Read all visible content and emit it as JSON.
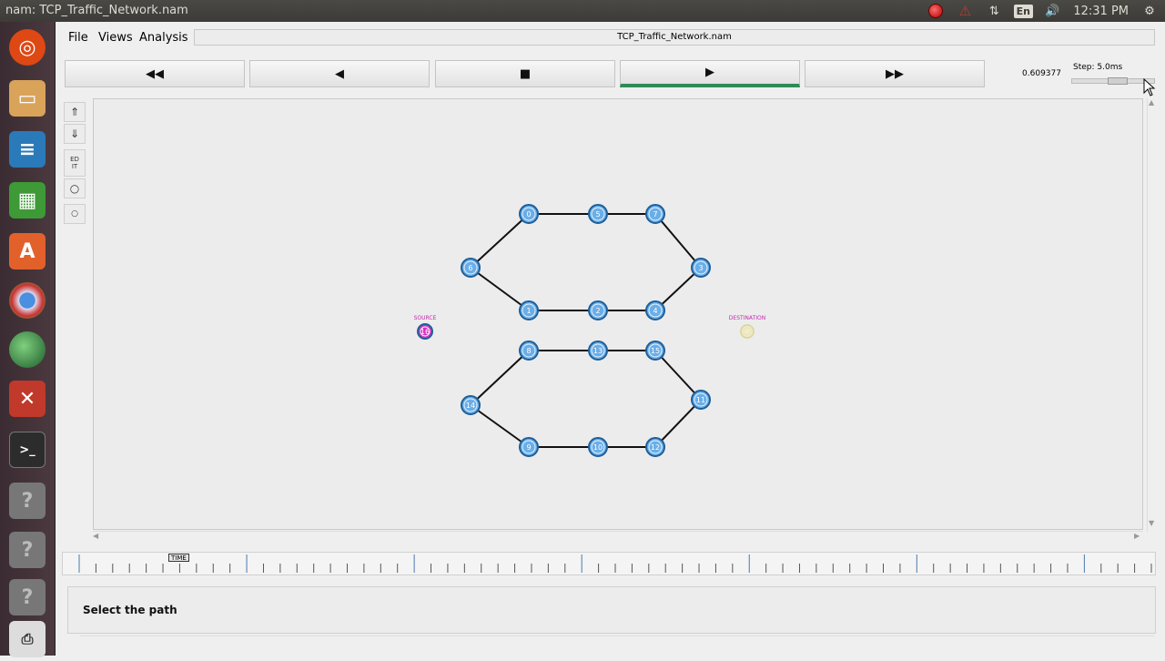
{
  "window": {
    "title": "nam: TCP_Traffic_Network.nam"
  },
  "tray": {
    "lang": "En",
    "clock": "12:31 PM"
  },
  "menu": {
    "file": "File",
    "views": "Views",
    "analysis": "Analysis"
  },
  "file_title": "TCP_Traffic_Network.nam",
  "controls": {
    "rewind": "◀◀",
    "back": "◀",
    "stop": "■",
    "play": "▶",
    "fast_forward": "▶▶",
    "time": "0.609377",
    "step_label": "Step: 5.0ms",
    "step_position": 0.55
  },
  "tools": {
    "edit": "ED\nIT"
  },
  "network": {
    "nodes": [
      {
        "id": "n0",
        "label": "0"
      },
      {
        "id": "n5",
        "label": "5"
      },
      {
        "id": "n7",
        "label": "7"
      },
      {
        "id": "n6",
        "label": "6"
      },
      {
        "id": "n3",
        "label": "3"
      },
      {
        "id": "n1",
        "label": "1"
      },
      {
        "id": "n2",
        "label": "2"
      },
      {
        "id": "n4",
        "label": "4"
      },
      {
        "id": "n8",
        "label": "8"
      },
      {
        "id": "n13",
        "label": "13"
      },
      {
        "id": "n15",
        "label": "15"
      },
      {
        "id": "n14",
        "label": "14"
      },
      {
        "id": "n11",
        "label": "11"
      },
      {
        "id": "n9",
        "label": "9"
      },
      {
        "id": "n10",
        "label": "10"
      },
      {
        "id": "n12",
        "label": "12"
      },
      {
        "id": "n16",
        "label": "16"
      },
      {
        "id": "n17",
        "label": ""
      }
    ],
    "links": [
      [
        "n0",
        "n5"
      ],
      [
        "n5",
        "n7"
      ],
      [
        "n7",
        "n3"
      ],
      [
        "n6",
        "n0"
      ],
      [
        "n6",
        "n1"
      ],
      [
        "n1",
        "n2"
      ],
      [
        "n2",
        "n4"
      ],
      [
        "n4",
        "n3"
      ],
      [
        "n8",
        "n13"
      ],
      [
        "n13",
        "n15"
      ],
      [
        "n15",
        "n11"
      ],
      [
        "n14",
        "n8"
      ],
      [
        "n14",
        "n9"
      ],
      [
        "n9",
        "n10"
      ],
      [
        "n10",
        "n12"
      ],
      [
        "n12",
        "n11"
      ]
    ],
    "source_label": "SOURCE",
    "destination_label": "DESTINATION",
    "node_color": "#6aaee8",
    "source_color": "#d633c0",
    "destination_color": "#f0ecc8"
  },
  "timeline": {
    "marker": "TIME"
  },
  "status": {
    "text": "Select the path"
  }
}
